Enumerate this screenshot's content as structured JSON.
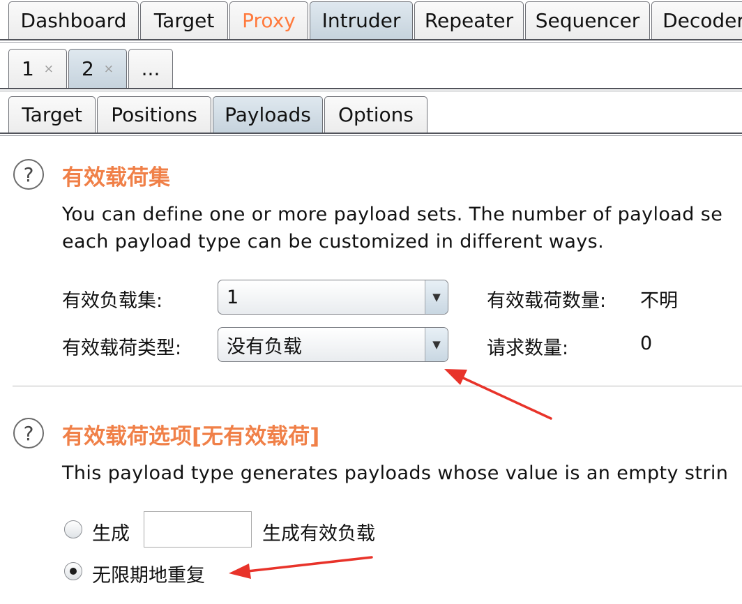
{
  "main_tabs": [
    {
      "label": "Dashboard"
    },
    {
      "label": "Target"
    },
    {
      "label": "Proxy"
    },
    {
      "label": "Intruder"
    },
    {
      "label": "Repeater"
    },
    {
      "label": "Sequencer"
    },
    {
      "label": "Decoder"
    }
  ],
  "attack_tabs": [
    {
      "label": "1",
      "close": "×"
    },
    {
      "label": "2",
      "close": "×"
    },
    {
      "label": "..."
    }
  ],
  "sub_tabs": [
    {
      "label": "Target"
    },
    {
      "label": "Positions"
    },
    {
      "label": "Payloads"
    },
    {
      "label": "Options"
    }
  ],
  "payload_sets": {
    "help_icon": "?",
    "title": "有效载荷集",
    "description_line1": "You can define one or more payload sets. The number of payload se",
    "description_line2": "each payload type can be customized in different ways.",
    "set_label": "有效负载集:",
    "set_value": "1",
    "type_label": "有效载荷类型:",
    "type_value": "没有负载",
    "count_label": "有效载荷数量:",
    "count_value": "不明",
    "request_label": "请求数量:",
    "request_value": "0"
  },
  "payload_options": {
    "help_icon": "?",
    "title": "有效载荷选项[无有效载荷]",
    "description": "This payload type generates payloads whose value is an empty strin",
    "generate_label": "生成",
    "generate_value": "",
    "generate_suffix": "生成有效负载",
    "repeat_label": "无限期地重复",
    "selected": "repeat"
  },
  "colors": {
    "accent_title": "#f08048",
    "proxy_tab": "#ff7a3d",
    "selected_tab": "#c6d3dd",
    "annotation_arrow": "#e8332a"
  },
  "icons": {
    "dropdown": "chevron-down-icon",
    "help": "help-icon",
    "close": "close-icon"
  }
}
